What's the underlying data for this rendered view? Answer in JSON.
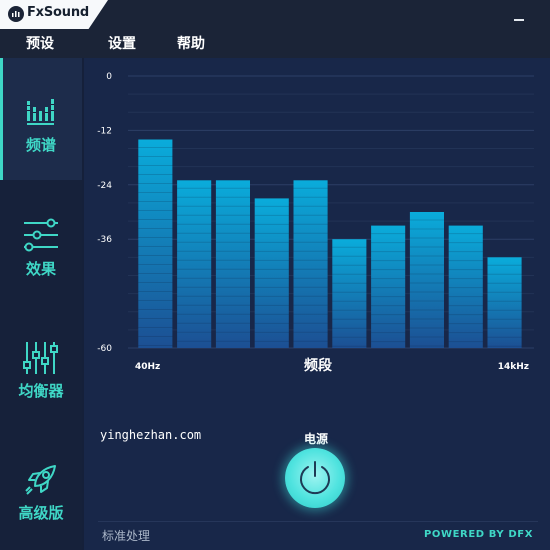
{
  "app": {
    "name": "FxSound"
  },
  "menu": {
    "items": [
      "预设",
      "设置",
      "帮助"
    ]
  },
  "sidebar": {
    "items": [
      {
        "label": "频谱",
        "icon": "spectrum-icon",
        "active": true
      },
      {
        "label": "效果",
        "icon": "sliders-icon",
        "active": false
      },
      {
        "label": "均衡器",
        "icon": "equalizer-icon",
        "active": false
      },
      {
        "label": "高级版",
        "icon": "rocket-icon",
        "active": false
      }
    ]
  },
  "chart_data": {
    "type": "bar",
    "categories": [
      "",
      "",
      "",
      "",
      "",
      "",
      "",
      "",
      "",
      ""
    ],
    "values": [
      -14,
      -23,
      -23,
      -27,
      -23,
      -36,
      -33,
      -30,
      -33,
      -40
    ],
    "ylim": [
      -60,
      0
    ],
    "yticks": [
      0,
      -12,
      -24,
      -36,
      -60
    ],
    "y_tick_labels": [
      "0",
      "-12",
      "-24",
      "-36",
      "-60"
    ],
    "x_start_label": "40Hz",
    "x_end_label": "14kHz",
    "xlabel": "频段",
    "grid": true,
    "colors": {
      "bar_top": "#0aacdb",
      "bar_bottom": "#1c4f93"
    }
  },
  "watermark": "yinghezhan.com",
  "power": {
    "label": "电源",
    "icon": "power-icon",
    "color": "#4fe3df"
  },
  "footer": {
    "status": "标准处理",
    "powered_by": "POWERED BY DFX"
  },
  "colors": {
    "accent": "#3fd7c6",
    "background": "#182749",
    "sidebar": "#16213a"
  }
}
